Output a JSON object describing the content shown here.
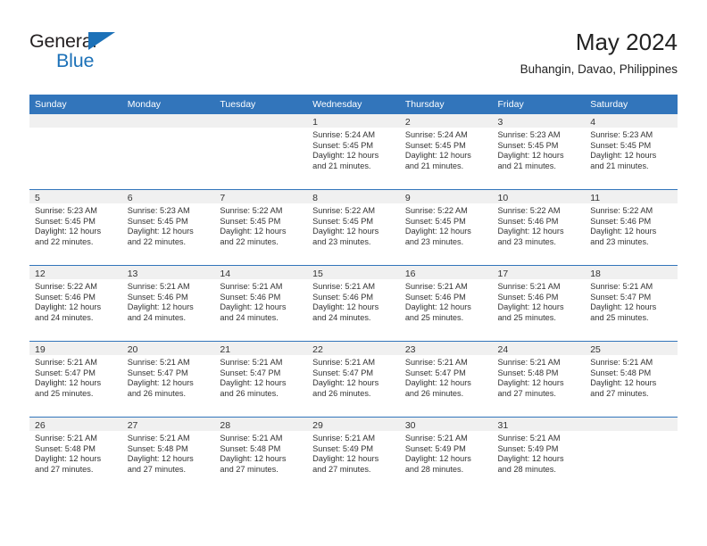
{
  "brand": {
    "name_primary": "General",
    "name_secondary": "Blue",
    "triangle_icon": "brand-triangle-icon",
    "accent_color": "#1c71b8"
  },
  "header": {
    "title": "May 2024",
    "subtitle": "Buhangin, Davao, Philippines",
    "header_bg_color": "#3275bb",
    "daynum_band_color": "#f0f0f0"
  },
  "weekdays": [
    "Sunday",
    "Monday",
    "Tuesday",
    "Wednesday",
    "Thursday",
    "Friday",
    "Saturday"
  ],
  "weeks": [
    [
      {
        "day": "",
        "empty": true,
        "sunrise": "",
        "sunset": "",
        "daylight_line1": "",
        "daylight_line2": ""
      },
      {
        "day": "",
        "empty": true,
        "sunrise": "",
        "sunset": "",
        "daylight_line1": "",
        "daylight_line2": ""
      },
      {
        "day": "",
        "empty": true,
        "sunrise": "",
        "sunset": "",
        "daylight_line1": "",
        "daylight_line2": ""
      },
      {
        "day": "1",
        "empty": false,
        "sunrise": "Sunrise: 5:24 AM",
        "sunset": "Sunset: 5:45 PM",
        "daylight_line1": "Daylight: 12 hours",
        "daylight_line2": "and 21 minutes."
      },
      {
        "day": "2",
        "empty": false,
        "sunrise": "Sunrise: 5:24 AM",
        "sunset": "Sunset: 5:45 PM",
        "daylight_line1": "Daylight: 12 hours",
        "daylight_line2": "and 21 minutes."
      },
      {
        "day": "3",
        "empty": false,
        "sunrise": "Sunrise: 5:23 AM",
        "sunset": "Sunset: 5:45 PM",
        "daylight_line1": "Daylight: 12 hours",
        "daylight_line2": "and 21 minutes."
      },
      {
        "day": "4",
        "empty": false,
        "sunrise": "Sunrise: 5:23 AM",
        "sunset": "Sunset: 5:45 PM",
        "daylight_line1": "Daylight: 12 hours",
        "daylight_line2": "and 21 minutes."
      }
    ],
    [
      {
        "day": "5",
        "empty": false,
        "sunrise": "Sunrise: 5:23 AM",
        "sunset": "Sunset: 5:45 PM",
        "daylight_line1": "Daylight: 12 hours",
        "daylight_line2": "and 22 minutes."
      },
      {
        "day": "6",
        "empty": false,
        "sunrise": "Sunrise: 5:23 AM",
        "sunset": "Sunset: 5:45 PM",
        "daylight_line1": "Daylight: 12 hours",
        "daylight_line2": "and 22 minutes."
      },
      {
        "day": "7",
        "empty": false,
        "sunrise": "Sunrise: 5:22 AM",
        "sunset": "Sunset: 5:45 PM",
        "daylight_line1": "Daylight: 12 hours",
        "daylight_line2": "and 22 minutes."
      },
      {
        "day": "8",
        "empty": false,
        "sunrise": "Sunrise: 5:22 AM",
        "sunset": "Sunset: 5:45 PM",
        "daylight_line1": "Daylight: 12 hours",
        "daylight_line2": "and 23 minutes."
      },
      {
        "day": "9",
        "empty": false,
        "sunrise": "Sunrise: 5:22 AM",
        "sunset": "Sunset: 5:45 PM",
        "daylight_line1": "Daylight: 12 hours",
        "daylight_line2": "and 23 minutes."
      },
      {
        "day": "10",
        "empty": false,
        "sunrise": "Sunrise: 5:22 AM",
        "sunset": "Sunset: 5:46 PM",
        "daylight_line1": "Daylight: 12 hours",
        "daylight_line2": "and 23 minutes."
      },
      {
        "day": "11",
        "empty": false,
        "sunrise": "Sunrise: 5:22 AM",
        "sunset": "Sunset: 5:46 PM",
        "daylight_line1": "Daylight: 12 hours",
        "daylight_line2": "and 23 minutes."
      }
    ],
    [
      {
        "day": "12",
        "empty": false,
        "sunrise": "Sunrise: 5:22 AM",
        "sunset": "Sunset: 5:46 PM",
        "daylight_line1": "Daylight: 12 hours",
        "daylight_line2": "and 24 minutes."
      },
      {
        "day": "13",
        "empty": false,
        "sunrise": "Sunrise: 5:21 AM",
        "sunset": "Sunset: 5:46 PM",
        "daylight_line1": "Daylight: 12 hours",
        "daylight_line2": "and 24 minutes."
      },
      {
        "day": "14",
        "empty": false,
        "sunrise": "Sunrise: 5:21 AM",
        "sunset": "Sunset: 5:46 PM",
        "daylight_line1": "Daylight: 12 hours",
        "daylight_line2": "and 24 minutes."
      },
      {
        "day": "15",
        "empty": false,
        "sunrise": "Sunrise: 5:21 AM",
        "sunset": "Sunset: 5:46 PM",
        "daylight_line1": "Daylight: 12 hours",
        "daylight_line2": "and 24 minutes."
      },
      {
        "day": "16",
        "empty": false,
        "sunrise": "Sunrise: 5:21 AM",
        "sunset": "Sunset: 5:46 PM",
        "daylight_line1": "Daylight: 12 hours",
        "daylight_line2": "and 25 minutes."
      },
      {
        "day": "17",
        "empty": false,
        "sunrise": "Sunrise: 5:21 AM",
        "sunset": "Sunset: 5:46 PM",
        "daylight_line1": "Daylight: 12 hours",
        "daylight_line2": "and 25 minutes."
      },
      {
        "day": "18",
        "empty": false,
        "sunrise": "Sunrise: 5:21 AM",
        "sunset": "Sunset: 5:47 PM",
        "daylight_line1": "Daylight: 12 hours",
        "daylight_line2": "and 25 minutes."
      }
    ],
    [
      {
        "day": "19",
        "empty": false,
        "sunrise": "Sunrise: 5:21 AM",
        "sunset": "Sunset: 5:47 PM",
        "daylight_line1": "Daylight: 12 hours",
        "daylight_line2": "and 25 minutes."
      },
      {
        "day": "20",
        "empty": false,
        "sunrise": "Sunrise: 5:21 AM",
        "sunset": "Sunset: 5:47 PM",
        "daylight_line1": "Daylight: 12 hours",
        "daylight_line2": "and 26 minutes."
      },
      {
        "day": "21",
        "empty": false,
        "sunrise": "Sunrise: 5:21 AM",
        "sunset": "Sunset: 5:47 PM",
        "daylight_line1": "Daylight: 12 hours",
        "daylight_line2": "and 26 minutes."
      },
      {
        "day": "22",
        "empty": false,
        "sunrise": "Sunrise: 5:21 AM",
        "sunset": "Sunset: 5:47 PM",
        "daylight_line1": "Daylight: 12 hours",
        "daylight_line2": "and 26 minutes."
      },
      {
        "day": "23",
        "empty": false,
        "sunrise": "Sunrise: 5:21 AM",
        "sunset": "Sunset: 5:47 PM",
        "daylight_line1": "Daylight: 12 hours",
        "daylight_line2": "and 26 minutes."
      },
      {
        "day": "24",
        "empty": false,
        "sunrise": "Sunrise: 5:21 AM",
        "sunset": "Sunset: 5:48 PM",
        "daylight_line1": "Daylight: 12 hours",
        "daylight_line2": "and 27 minutes."
      },
      {
        "day": "25",
        "empty": false,
        "sunrise": "Sunrise: 5:21 AM",
        "sunset": "Sunset: 5:48 PM",
        "daylight_line1": "Daylight: 12 hours",
        "daylight_line2": "and 27 minutes."
      }
    ],
    [
      {
        "day": "26",
        "empty": false,
        "sunrise": "Sunrise: 5:21 AM",
        "sunset": "Sunset: 5:48 PM",
        "daylight_line1": "Daylight: 12 hours",
        "daylight_line2": "and 27 minutes."
      },
      {
        "day": "27",
        "empty": false,
        "sunrise": "Sunrise: 5:21 AM",
        "sunset": "Sunset: 5:48 PM",
        "daylight_line1": "Daylight: 12 hours",
        "daylight_line2": "and 27 minutes."
      },
      {
        "day": "28",
        "empty": false,
        "sunrise": "Sunrise: 5:21 AM",
        "sunset": "Sunset: 5:48 PM",
        "daylight_line1": "Daylight: 12 hours",
        "daylight_line2": "and 27 minutes."
      },
      {
        "day": "29",
        "empty": false,
        "sunrise": "Sunrise: 5:21 AM",
        "sunset": "Sunset: 5:49 PM",
        "daylight_line1": "Daylight: 12 hours",
        "daylight_line2": "and 27 minutes."
      },
      {
        "day": "30",
        "empty": false,
        "sunrise": "Sunrise: 5:21 AM",
        "sunset": "Sunset: 5:49 PM",
        "daylight_line1": "Daylight: 12 hours",
        "daylight_line2": "and 28 minutes."
      },
      {
        "day": "31",
        "empty": false,
        "sunrise": "Sunrise: 5:21 AM",
        "sunset": "Sunset: 5:49 PM",
        "daylight_line1": "Daylight: 12 hours",
        "daylight_line2": "and 28 minutes."
      },
      {
        "day": "",
        "empty": true,
        "sunrise": "",
        "sunset": "",
        "daylight_line1": "",
        "daylight_line2": ""
      }
    ]
  ]
}
